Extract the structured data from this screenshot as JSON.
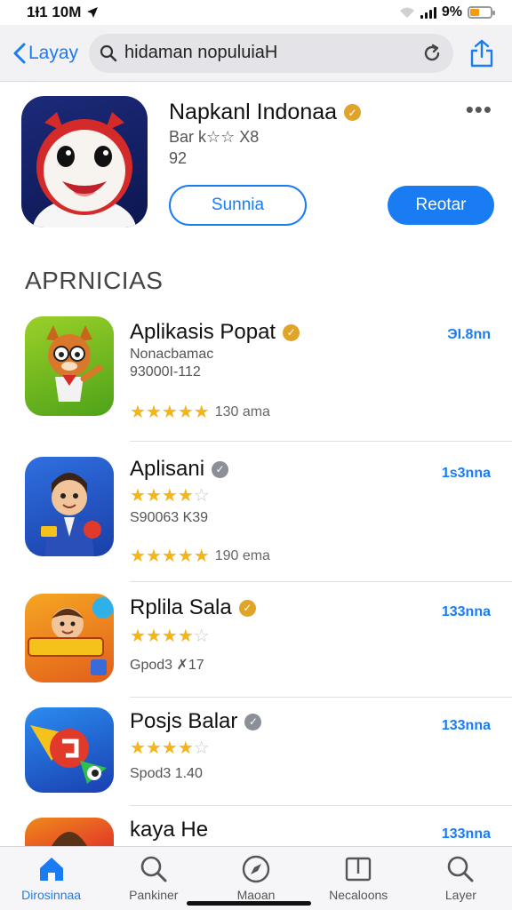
{
  "status_bar": {
    "time": "1Ɨ1 10M",
    "battery_percent": "9%",
    "battery_level": 0.45
  },
  "nav": {
    "back_label": "Layay",
    "search_value": "hidaman nopuluiaH"
  },
  "featured": {
    "title": "Napkanl Indonaa",
    "badge_color": "#e0a428",
    "subtitle": "Bar k☆☆ X8",
    "number": "92",
    "secondary_button": "Sunnia",
    "primary_button": "Reotar"
  },
  "section_title": "APRNICIAS",
  "apps": [
    {
      "name": "Aplikasis Popat",
      "badge": "gold",
      "developer": "Nonacbamac",
      "meta": "93000I-112",
      "rating": 4.5,
      "rating_count": "130 ama",
      "price": "ЭI.8nn"
    },
    {
      "name": "Aplisani",
      "badge": "gray",
      "rating_top": 3.5,
      "meta": "S90063 K39",
      "rating": 4.5,
      "rating_count": "190 ema",
      "price": "1s3nna"
    },
    {
      "name": "Rplila Sala",
      "badge": "gold",
      "rating_top": 3.5,
      "meta": "Gpod3 ✗17",
      "price": "133nna"
    },
    {
      "name": "Posjs Balar",
      "badge": "gray",
      "rating_top": 3.5,
      "meta": "Spod3 1.40",
      "price": "133nna"
    },
    {
      "name": "kaya He",
      "price": "133nna"
    }
  ],
  "tabs": [
    {
      "label": "Dirosinnaa",
      "icon": "home-icon",
      "active": true
    },
    {
      "label": "Pankiner",
      "icon": "search-icon",
      "active": false
    },
    {
      "label": "Maoan",
      "icon": "compass-icon",
      "active": false
    },
    {
      "label": "Necaloons",
      "icon": "book-icon",
      "active": false
    },
    {
      "label": "Layer",
      "icon": "search-icon",
      "active": false
    }
  ],
  "colors": {
    "accent": "#1a7cf2",
    "star": "#f5b417",
    "badge_gold": "#e0a428",
    "badge_gray": "#8b8f98"
  }
}
